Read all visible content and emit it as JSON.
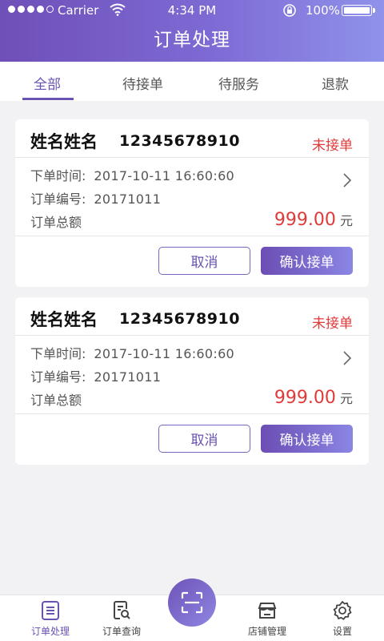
{
  "status_bar": {
    "carrier": "Carrier",
    "time": "4:34 PM",
    "battery": "100%"
  },
  "header": {
    "title": "订单处理"
  },
  "tabs": [
    {
      "label": "全部",
      "active": true
    },
    {
      "label": "待接单",
      "active": false
    },
    {
      "label": "待服务",
      "active": false
    },
    {
      "label": "退款",
      "active": false
    }
  ],
  "orders": [
    {
      "customer_name": "姓名姓名",
      "phone": "12345678910",
      "status": "未接单",
      "time_label": "下单时间:",
      "time": "2017-10-11  16:60:60",
      "number_label": "订单编号:",
      "number": "20171011",
      "total_label": "订单总额",
      "amount": "999.00",
      "currency": "元",
      "cancel_label": "取消",
      "confirm_label": "确认接单"
    },
    {
      "customer_name": "姓名姓名",
      "phone": "12345678910",
      "status": "未接单",
      "time_label": "下单时间:",
      "time": "2017-10-11  16:60:60",
      "number_label": "订单编号:",
      "number": "20171011",
      "total_label": "订单总额",
      "amount": "999.00",
      "currency": "元",
      "cancel_label": "取消",
      "confirm_label": "确认接单"
    }
  ],
  "bottom_nav": [
    {
      "label": "订单处理",
      "icon": "order-list-icon",
      "active": true
    },
    {
      "label": "订单查询",
      "icon": "order-search-icon",
      "active": false
    },
    {
      "label": "",
      "icon": "scan-icon",
      "active": false
    },
    {
      "label": "店铺管理",
      "icon": "store-icon",
      "active": false
    },
    {
      "label": "设置",
      "icon": "gear-icon",
      "active": false
    }
  ],
  "colors": {
    "accent": "#6a52b2",
    "header_gradient_start": "#6f4fb8",
    "header_gradient_end": "#8f92ea",
    "status_red": "#e03a3a",
    "background": "#f2f2f4"
  }
}
